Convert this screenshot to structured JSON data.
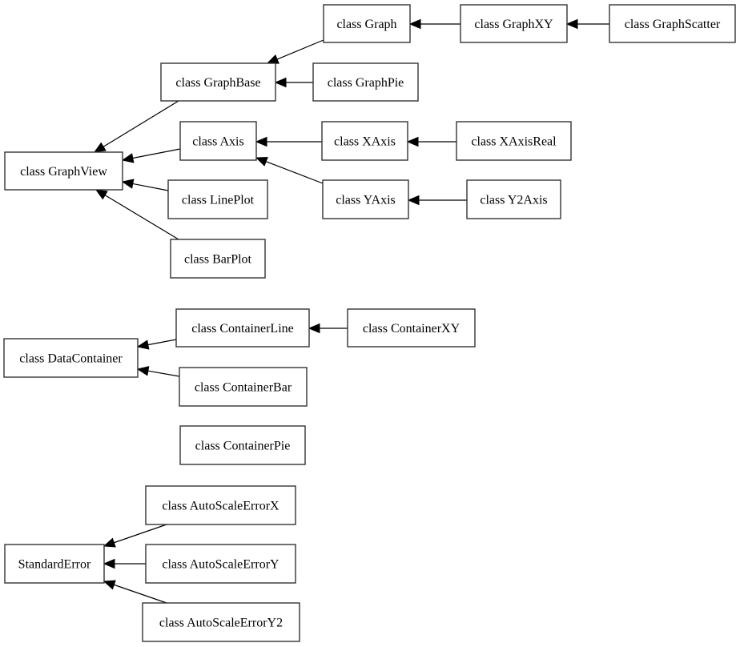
{
  "diagram": {
    "type": "class-inheritance-graph",
    "direction": "right-to-left (child → parent)",
    "nodes": [
      {
        "id": "Graph",
        "label": "class Graph"
      },
      {
        "id": "GraphXY",
        "label": "class GraphXY"
      },
      {
        "id": "GraphScatter",
        "label": "class GraphScatter"
      },
      {
        "id": "GraphBase",
        "label": "class GraphBase"
      },
      {
        "id": "GraphPie",
        "label": "class GraphPie"
      },
      {
        "id": "Axis",
        "label": "class Axis"
      },
      {
        "id": "XAxis",
        "label": "class XAxis"
      },
      {
        "id": "XAxisReal",
        "label": "class XAxisReal"
      },
      {
        "id": "GraphView",
        "label": "class GraphView"
      },
      {
        "id": "LinePlot",
        "label": "class LinePlot"
      },
      {
        "id": "YAxis",
        "label": "class YAxis"
      },
      {
        "id": "Y2Axis",
        "label": "class Y2Axis"
      },
      {
        "id": "BarPlot",
        "label": "class BarPlot"
      },
      {
        "id": "ContainerLine",
        "label": "class ContainerLine"
      },
      {
        "id": "ContainerXY",
        "label": "class ContainerXY"
      },
      {
        "id": "DataContainer",
        "label": "class DataContainer"
      },
      {
        "id": "ContainerBar",
        "label": "class ContainerBar"
      },
      {
        "id": "ContainerPie",
        "label": "class ContainerPie"
      },
      {
        "id": "AutoScaleErrorX",
        "label": "class AutoScaleErrorX"
      },
      {
        "id": "StandardError",
        "label": "StandardError"
      },
      {
        "id": "AutoScaleErrorY",
        "label": "class AutoScaleErrorY"
      },
      {
        "id": "AutoScaleErrorY2",
        "label": "class AutoScaleErrorY2"
      }
    ],
    "edges": [
      {
        "from": "GraphXY",
        "to": "Graph"
      },
      {
        "from": "GraphScatter",
        "to": "GraphXY"
      },
      {
        "from": "Graph",
        "to": "GraphBase"
      },
      {
        "from": "GraphPie",
        "to": "GraphBase"
      },
      {
        "from": "GraphBase",
        "to": "GraphView"
      },
      {
        "from": "Axis",
        "to": "GraphView"
      },
      {
        "from": "LinePlot",
        "to": "GraphView"
      },
      {
        "from": "BarPlot",
        "to": "GraphView"
      },
      {
        "from": "XAxis",
        "to": "Axis"
      },
      {
        "from": "YAxis",
        "to": "Axis"
      },
      {
        "from": "XAxisReal",
        "to": "XAxis"
      },
      {
        "from": "Y2Axis",
        "to": "YAxis"
      },
      {
        "from": "ContainerLine",
        "to": "DataContainer"
      },
      {
        "from": "ContainerBar",
        "to": "DataContainer"
      },
      {
        "from": "ContainerXY",
        "to": "ContainerLine"
      },
      {
        "from": "AutoScaleErrorX",
        "to": "StandardError"
      },
      {
        "from": "AutoScaleErrorY",
        "to": "StandardError"
      },
      {
        "from": "AutoScaleErrorY2",
        "to": "StandardError"
      }
    ]
  }
}
